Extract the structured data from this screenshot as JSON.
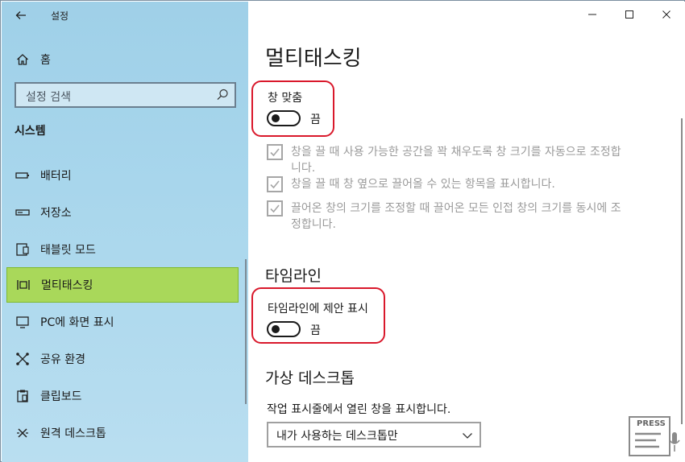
{
  "window": {
    "title": "설정"
  },
  "sidebar": {
    "home_label": "홈",
    "search_placeholder": "설정 검색",
    "section_title": "시스템",
    "items": [
      {
        "label": "배터리",
        "icon": "battery-icon"
      },
      {
        "label": "저장소",
        "icon": "storage-icon"
      },
      {
        "label": "태블릿 모드",
        "icon": "tablet-mode-icon"
      },
      {
        "label": "멀티태스킹",
        "icon": "multitasking-icon",
        "active": true
      },
      {
        "label": "PC에 화면 표시",
        "icon": "project-icon"
      },
      {
        "label": "공유 환경",
        "icon": "shared-experiences-icon"
      },
      {
        "label": "클립보드",
        "icon": "clipboard-icon"
      },
      {
        "label": "원격 데스크톱",
        "icon": "remote-desktop-icon"
      }
    ]
  },
  "main": {
    "title": "멀티태스킹",
    "snap": {
      "label": "창 맞춤",
      "toggle_state": "끔",
      "options": [
        "창을 끌 때 사용 가능한 공간을 꽉 채우도록 창 크기를 자동으로 조정합니다.",
        "창을 끌 때 창 옆으로 끌어올 수 있는 항목을 표시합니다.",
        "끌어온 창의 크기를 조정할 때 끌어온 모든 인접 창의 크기를 동시에 조정합니다."
      ]
    },
    "timeline": {
      "heading": "타임라인",
      "label": "타임라인에 제안 표시",
      "toggle_state": "끔"
    },
    "virtual_desktops": {
      "heading": "가상 데스크톱",
      "description": "작업 표시줄에서 열린 창을 표시합니다.",
      "dropdown_value": "내가 사용하는 데스크톱만"
    }
  },
  "watermark": {
    "text": "PRESS"
  },
  "colors": {
    "sidebar_bg": "#a8d6ec",
    "active_item": "#a9d85a",
    "highlight_border": "#d9182b"
  }
}
